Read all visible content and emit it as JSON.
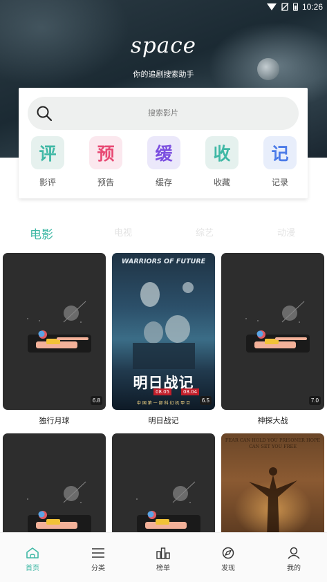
{
  "status_bar": {
    "time": "10:26",
    "icons": [
      "wifi-icon",
      "no-sim-icon",
      "battery-icon"
    ]
  },
  "header": {
    "brand": "space",
    "tagline": "你的追剧搜索助手"
  },
  "search": {
    "placeholder": "搜索影片"
  },
  "quick_actions": [
    {
      "glyph": "评",
      "label": "影评",
      "bg": "#e6f1ee",
      "fg": "#3fb8a5"
    },
    {
      "glyph": "预",
      "label": "预告",
      "bg": "#fbe8ee",
      "fg": "#e84a74"
    },
    {
      "glyph": "缓",
      "label": "缓存",
      "bg": "#ebe8fa",
      "fg": "#7c4fe0"
    },
    {
      "glyph": "收",
      "label": "收藏",
      "bg": "#e5f1ee",
      "fg": "#3fb8a5"
    },
    {
      "glyph": "记",
      "label": "记录",
      "bg": "#e8eefb",
      "fg": "#4b7be8"
    }
  ],
  "tabs": [
    "电影",
    "电视",
    "综艺",
    "动漫"
  ],
  "active_tab": 0,
  "movies": [
    {
      "title": "独行月球",
      "rating": "6.8",
      "poster": "placeholder"
    },
    {
      "title": "明日战记",
      "rating": "6.5",
      "poster": "warriors"
    },
    {
      "title": "神探大战",
      "rating": "7.0",
      "poster": "placeholder"
    }
  ],
  "posters_row2": [
    "placeholder",
    "placeholder",
    "shawshank"
  ],
  "warriors_poster": {
    "english_title": "WARRIORS OF FUTURE",
    "chinese_title": "明日战记",
    "date_1": "08.05",
    "date_2": "08.04",
    "tagline": "中 国 第 一 部 科 幻 机 甲 巨"
  },
  "shawshank_poster": {
    "tagline": "FEAR CAN HOLD YOU PRISONER HOPE CAN SET YOU FREE"
  },
  "bottom_nav": [
    {
      "label": "首页",
      "icon": "home-icon"
    },
    {
      "label": "分类",
      "icon": "list-icon"
    },
    {
      "label": "榜单",
      "icon": "ranking-icon"
    },
    {
      "label": "发现",
      "icon": "discover-icon"
    },
    {
      "label": "我的",
      "icon": "profile-icon"
    }
  ],
  "active_nav": 0,
  "colors": {
    "accent": "#3fb8a5",
    "tab_inactive": "#e3e3e3",
    "placeholder_bg": "#2d2d2d"
  }
}
